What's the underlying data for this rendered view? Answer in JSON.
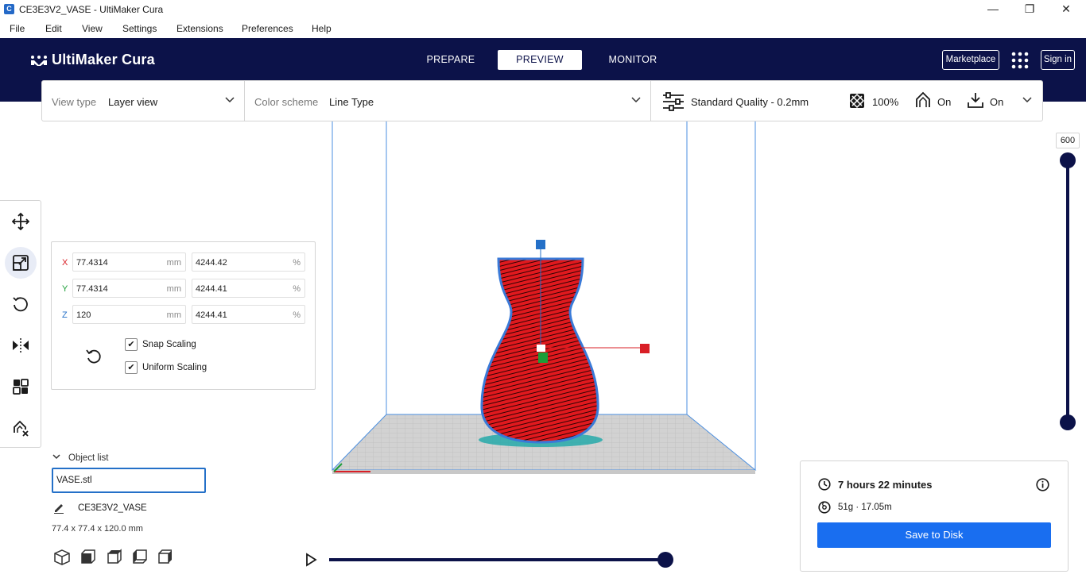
{
  "window": {
    "title": "CE3E3V2_VASE - UltiMaker Cura",
    "app_icon_letter": "C",
    "controls": [
      "minimize-icon",
      "restore-icon",
      "close-icon"
    ]
  },
  "menu": {
    "items": [
      "File",
      "Edit",
      "View",
      "Settings",
      "Extensions",
      "Preferences",
      "Help"
    ]
  },
  "header": {
    "logo": "UltiMaker Cura",
    "stages": [
      {
        "label": "PREPARE",
        "active": false
      },
      {
        "label": "PREVIEW",
        "active": true
      },
      {
        "label": "MONITOR",
        "active": false
      }
    ],
    "marketplace": "Marketplace",
    "apps_icon": "grid-icon",
    "signin": "Sign in"
  },
  "settings_bar": {
    "view_type_label": "View type",
    "view_type_value": "Layer view",
    "color_scheme_label": "Color scheme",
    "color_scheme_value": "Line Type",
    "quality": "Standard Quality - 0.2mm",
    "infill": "100%",
    "support": "On",
    "adhesion": "On"
  },
  "toolbar": {
    "tools": [
      "move-icon",
      "scale-icon",
      "rotate-icon",
      "mirror-icon",
      "per-model-settings-icon",
      "support-blocker-icon"
    ],
    "active_index": 1
  },
  "scale_panel": {
    "axes": [
      {
        "axis": "X",
        "mm": "77.4314",
        "unit_mm": "mm",
        "percent": "4244.42",
        "unit_pct": "%",
        "color": "#d91f26"
      },
      {
        "axis": "Y",
        "mm": "77.4314",
        "unit_mm": "mm",
        "percent": "4244.41",
        "unit_pct": "%",
        "color": "#1c9e38"
      },
      {
        "axis": "Z",
        "mm": "120",
        "unit_mm": "mm",
        "percent": "4244.41",
        "unit_pct": "%",
        "color": "#2470c8"
      }
    ],
    "snap_scaling": "Snap Scaling",
    "uniform_scaling": "Uniform Scaling"
  },
  "object_list": {
    "header": "Object list",
    "selected": "VASE.stl",
    "job_name": "CE3E3V2_VASE",
    "dimensions": "77.4 x 77.4 x 120.0 mm"
  },
  "print_info": {
    "time": "7 hours 22 minutes",
    "material": "51g · 17.05m",
    "save_button": "Save to Disk"
  },
  "layer_slider": {
    "value": "600"
  },
  "colors": {
    "header_bg": "#0c1249",
    "accent": "#196ef0",
    "model_red": "#e0191e",
    "axis_red": "#d91f26",
    "axis_green": "#1c9e38",
    "axis_blue": "#2470c8"
  }
}
